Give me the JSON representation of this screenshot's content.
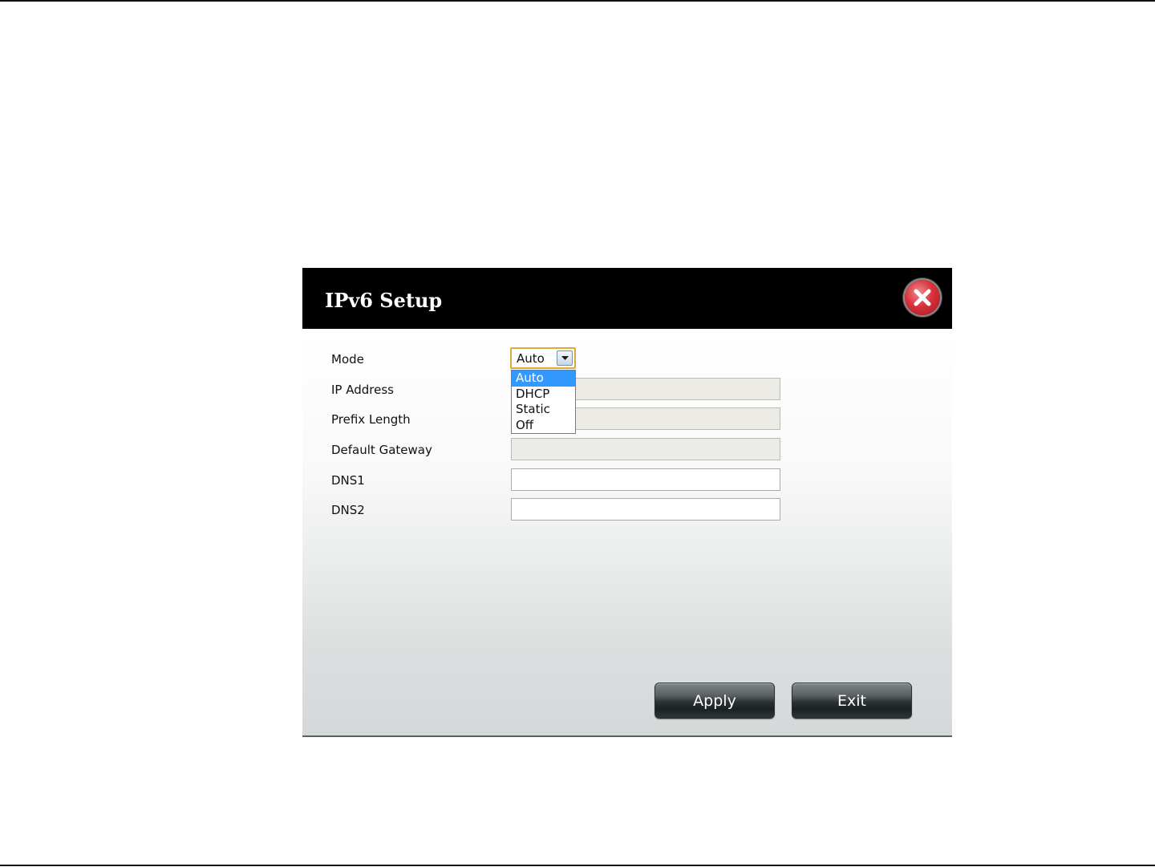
{
  "dialog": {
    "title": "IPv6 Setup",
    "close_icon": "close-x-icon"
  },
  "form": {
    "mode": {
      "label": "Mode",
      "selected": "Auto",
      "options": [
        "Auto",
        "DHCP",
        "Static",
        "Off"
      ],
      "highlighted_option": "Auto",
      "dropdown_open": true
    },
    "ip_address": {
      "label": "IP Address",
      "value": "",
      "disabled": true
    },
    "prefix_length": {
      "label": "Prefix Length",
      "value": "",
      "disabled": true
    },
    "default_gateway": {
      "label": "Default Gateway",
      "value": "",
      "disabled": true
    },
    "dns1": {
      "label": "DNS1",
      "value": "",
      "disabled": false
    },
    "dns2": {
      "label": "DNS2",
      "value": "",
      "disabled": false
    }
  },
  "buttons": {
    "apply_label": "Apply",
    "exit_label": "Exit"
  },
  "colors": {
    "header_bg": "#000000",
    "close_red": "#d9323c",
    "select_focus_border": "#e0a83a",
    "option_highlight": "#3399ff",
    "disabled_field_bg": "#ecebe6"
  }
}
